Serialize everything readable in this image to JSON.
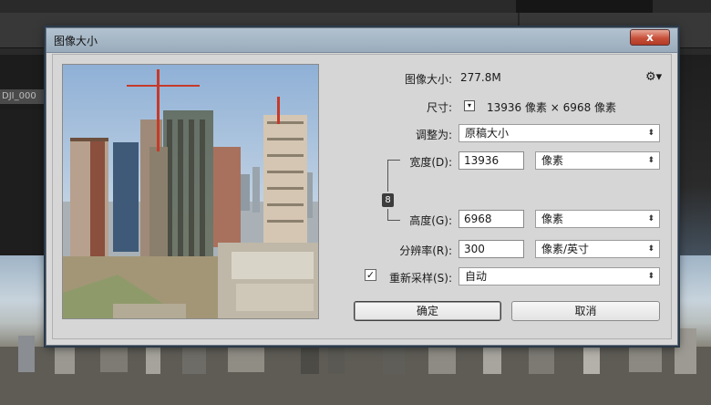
{
  "background": {
    "tab_label": "DJI_000"
  },
  "dialog": {
    "title": "图像大小",
    "close_glyph": "x",
    "image_size_label": "图像大小:",
    "image_size_value": "277.8M",
    "settings_icon": "gear-icon",
    "dimensions_label": "尺寸:",
    "dimensions_value": "13936 像素 × 6968 像素",
    "fit_to_label": "调整为:",
    "fit_to_value": "原稿大小",
    "width_label": "宽度(D):",
    "width_value": "13936",
    "width_unit": "像素",
    "height_label": "高度(G):",
    "height_value": "6968",
    "height_unit": "像素",
    "resolution_label": "分辨率(R):",
    "resolution_value": "300",
    "resolution_unit": "像素/英寸",
    "resample_checked": true,
    "resample_label": "重新采样(S):",
    "resample_value": "自动",
    "ok_label": "确定",
    "cancel_label": "取消"
  }
}
